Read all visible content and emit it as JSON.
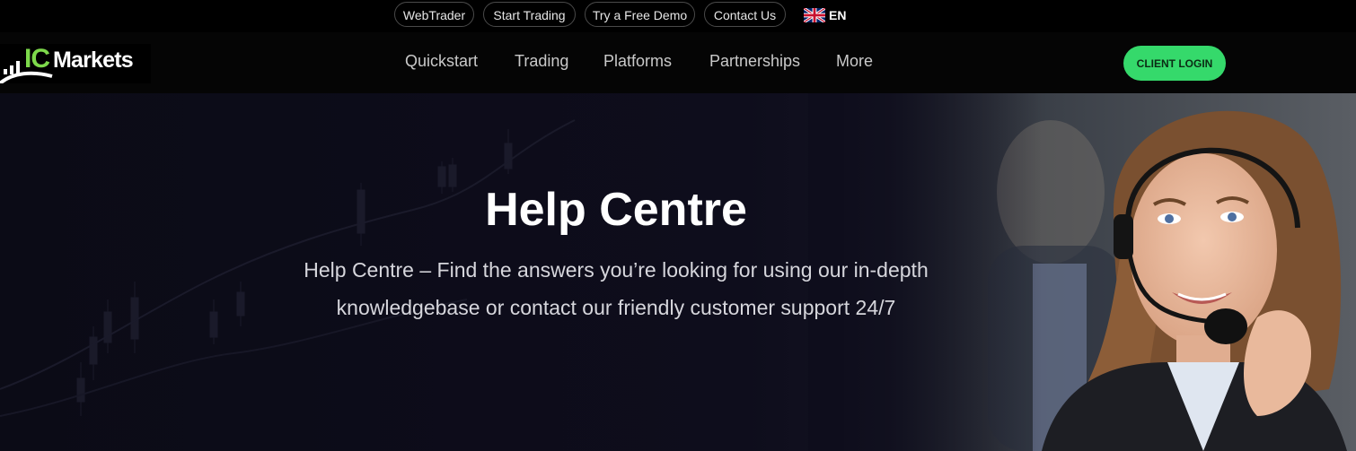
{
  "topbar": {
    "links": [
      "WebTrader",
      "Start Trading",
      "Try a Free Demo",
      "Contact Us"
    ],
    "language": {
      "code": "EN",
      "flag_icon": "uk-flag-icon"
    }
  },
  "brand": {
    "logo_prefix": "IC",
    "logo_suffix": "Markets",
    "accent": "#7dd94b"
  },
  "nav": {
    "items": [
      "Quickstart",
      "Trading",
      "Platforms",
      "Partnerships",
      "More"
    ],
    "login_label": "CLIENT LOGIN",
    "login_color": "#35d96b"
  },
  "hero": {
    "title": "Help Centre",
    "subtitle_line1": "Help Centre – Find the answers you’re looking for using our in-depth",
    "subtitle_line2": "knowledgebase or contact our friendly customer support 24/7"
  }
}
